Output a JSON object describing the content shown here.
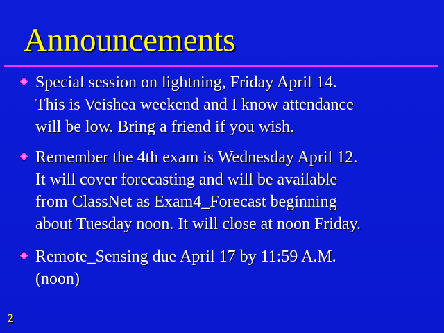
{
  "slide": {
    "title": "Announcements",
    "bullets": [
      {
        "icon": "diamond-bullet-icon",
        "text": "Special session on lightning, Friday April 14.\nThis is Veishea weekend and I know attendance\nwill be low. Bring a friend if you wish."
      },
      {
        "icon": "diamond-bullet-icon",
        "text": "Remember the 4th exam is Wednesday April 12.\nIt will cover forecasting and will be available\nfrom ClassNet as Exam4_Forecast beginning\nabout Tuesday noon. It will close at noon Friday."
      },
      {
        "icon": "diamond-bullet-icon",
        "text": "Remote_Sensing due  April 17 by 11:59 A.M.\n(noon)"
      }
    ],
    "page_number": "2"
  },
  "colors": {
    "background": "#0b1bd6",
    "title": "#ffff00",
    "rule": "#ff33ff",
    "bullet_icon": "#ff33ff",
    "body_text": "#ffffff"
  }
}
